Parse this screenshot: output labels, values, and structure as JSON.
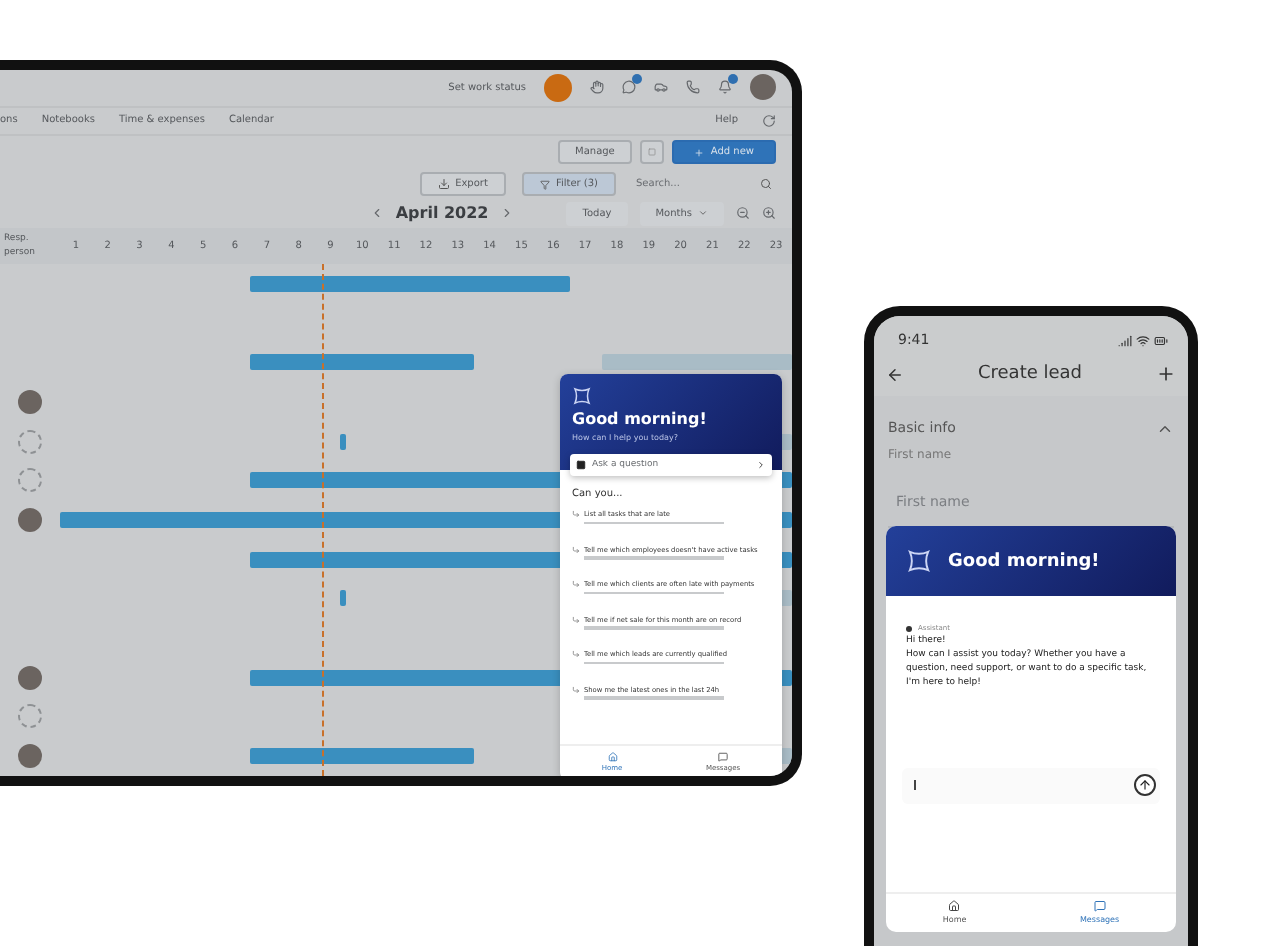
{
  "tablet": {
    "top_bar": {
      "work_status": "Set work status"
    },
    "nav": [
      "ons",
      "Notebooks",
      "Time & expenses",
      "Calendar"
    ],
    "help": "Help",
    "actions": {
      "manage": "Manage",
      "add_new": "Add new"
    },
    "toolbar": {
      "export": "Export",
      "filter": "Filter (3)",
      "search_placeholder": "Search..."
    },
    "period": {
      "label": "April 2022",
      "today": "Today",
      "scale": "Months"
    },
    "gantt": {
      "person_header": "Resp. person",
      "days": [
        "1",
        "2",
        "3",
        "4",
        "5",
        "6",
        "7",
        "8",
        "9",
        "10",
        "11",
        "12",
        "13",
        "14",
        "15",
        "16",
        "17",
        "18",
        "19",
        "20",
        "21",
        "22",
        "23"
      ],
      "rows": [
        {
          "kind": "blank"
        },
        {
          "kind": "blank"
        },
        {
          "kind": "blank"
        },
        {
          "kind": "photo"
        },
        {
          "kind": "placeholder"
        },
        {
          "kind": "placeholder"
        },
        {
          "kind": "photo"
        },
        {
          "kind": "blank"
        },
        {
          "kind": "blank"
        },
        {
          "kind": "blank"
        },
        {
          "kind": "photo"
        },
        {
          "kind": "placeholder"
        },
        {
          "kind": "photo"
        }
      ]
    },
    "assistant": {
      "title": "Good morning!",
      "subtitle": "How can I help you today?",
      "ask_placeholder": "Ask a question",
      "suggestions_title": "Can you...",
      "suggestions": [
        "List all tasks that are late",
        "Tell me which employees doesn't have active tasks",
        "Tell me which clients are often late with payments",
        "Tell me if net sale for this month are on record",
        "Tell me which leads are currently qualified",
        "Show me the latest ones in the last 24h"
      ],
      "tabs": [
        {
          "kind": "home",
          "label": "Home",
          "selected": true
        },
        {
          "kind": "messages",
          "label": "Messages",
          "selected": false
        }
      ]
    }
  },
  "phone": {
    "time": "9:41",
    "title": "Create lead",
    "section": "Basic info",
    "expanded": true,
    "field_label": "First name",
    "field_placeholder": "First name",
    "assistant": {
      "title": "Good morning!",
      "sender": "Assistant",
      "greeting": "Hi there!",
      "message": "How can I assist you today? Whether you have a question, need support, or want to do a specific task, I'm here to help!",
      "tabs": [
        {
          "kind": "home",
          "label": "Home",
          "selected": false
        },
        {
          "kind": "messages",
          "label": "Messages",
          "selected": true
        }
      ]
    }
  }
}
